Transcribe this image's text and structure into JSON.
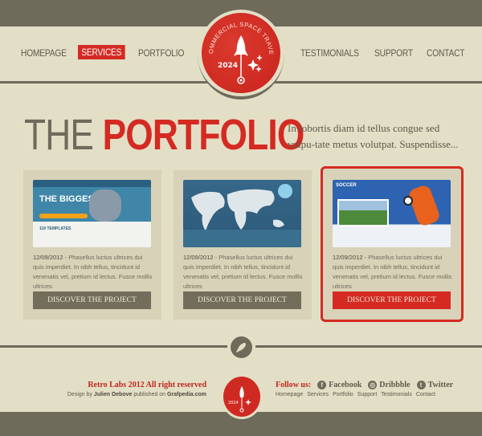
{
  "nav": {
    "left": [
      "HOMEPAGE",
      "SERVICES",
      "PORTFOLIO"
    ],
    "right": [
      "TESTIMONIALS",
      "SUPPORT",
      "CONTACT"
    ],
    "active": "SERVICES"
  },
  "badge": {
    "arc_text": "COMMERCIAL SPACE TRAVEL",
    "year": "2024"
  },
  "hero": {
    "title_a": "THE",
    "title_b": "PORTFOLIO",
    "intro": "In lobortis diam id tellus congue sed vulpu-tate metus volutpat. Suspendisse..."
  },
  "cards": [
    {
      "thumb_title": "THE BIGGEST",
      "thumb_sub": "119 TEMPLATES",
      "date": "12/09/2012",
      "text": " - Phasellus luctus ultrices dui quis imperdiet. In nibh tellus, tincidunt id venenatis vel, pretium id lectus. Fusce mollis ultrices",
      "button": "DISCOVER THE PROJECT"
    },
    {
      "date": "12/09/2012",
      "text": " - Phasellus luctus ultrices dui quis imperdiet. In nibh tellus, tincidunt id venenatis vel, pretium id lectus. Fusce mollis ultrices",
      "button": "DISCOVER THE PROJECT"
    },
    {
      "thumb_title": "SOCCER",
      "date": "12/09/2012",
      "text": " - Phasellus luctus ultrices dui quis imperdiet. In nibh tellus, tincidunt id venenatis vel, pretium id lectus. Fusce mollis ultrices",
      "button": "DISCOVER THE PROJECT",
      "selected": true
    }
  ],
  "footer": {
    "copyright": "Retro Labs 2012 All right reserved",
    "design_prefix": "Design by ",
    "designer": "Julien Debove",
    "published": " published on ",
    "site": "Grafpedia.com",
    "follow": "Follow us:",
    "social": [
      {
        "label": "Facebook",
        "icon": "facebook-icon"
      },
      {
        "label": "Dribbble",
        "icon": "dribbble-icon"
      },
      {
        "label": "Twitter",
        "icon": "twitter-icon"
      }
    ],
    "links": [
      "Homepage",
      "Services",
      "Portfolio",
      "Support",
      "Testimonials",
      "Contact"
    ]
  },
  "colors": {
    "accent": "#d42a22",
    "dark": "#6e6b5b",
    "background": "#e3dec6",
    "card": "#d8d2b8"
  }
}
